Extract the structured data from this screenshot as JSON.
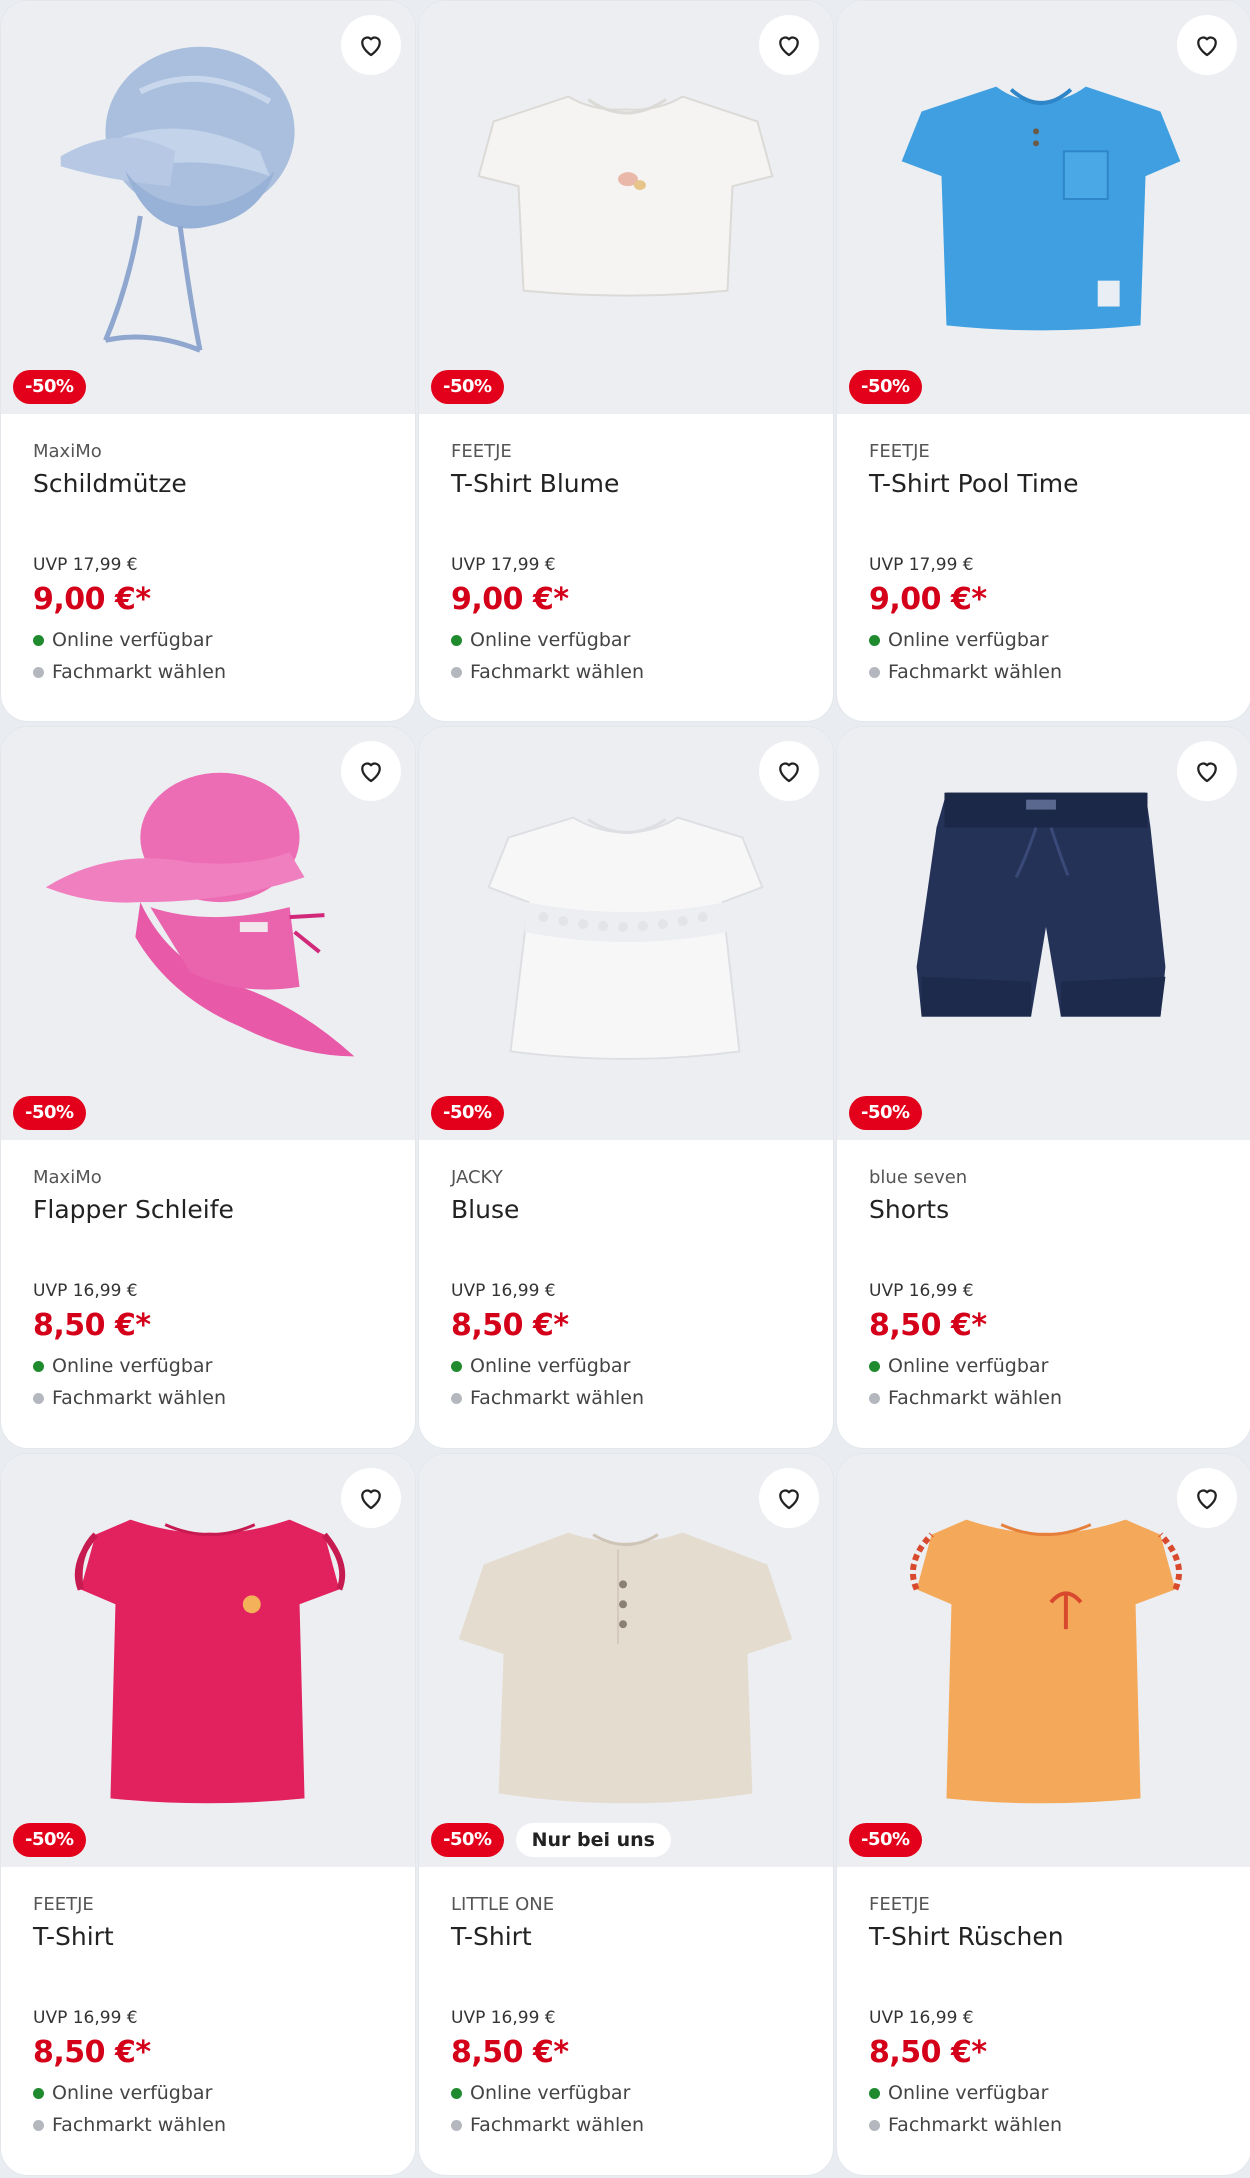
{
  "colors": {
    "sale_badge": "#e2001a",
    "price": "#d40019",
    "online_dot": "#1f8a2e",
    "store_dot": "#b4b8be",
    "image_bg": "#eceef2"
  },
  "products": [
    {
      "brand": "MaxiMo",
      "name": "Schildmütze",
      "uvp": "UVP 17,99 €",
      "price": "9,00 €*",
      "discount": "-50%",
      "note": "",
      "online": "Online verfügbar",
      "store": "Fachmarkt wählen",
      "icon": "light-blue-cap-icon"
    },
    {
      "brand": "FEETJE",
      "name": "T-Shirt Blume",
      "uvp": "UVP 17,99 €",
      "price": "9,00 €*",
      "discount": "-50%",
      "note": "",
      "online": "Online verfügbar",
      "store": "Fachmarkt wählen",
      "icon": "white-tshirt-icon"
    },
    {
      "brand": "FEETJE",
      "name": "T-Shirt Pool Time",
      "uvp": "UVP 17,99 €",
      "price": "9,00 €*",
      "discount": "-50%",
      "note": "",
      "online": "Online verfügbar",
      "store": "Fachmarkt wählen",
      "icon": "blue-tshirt-icon"
    },
    {
      "brand": "MaxiMo",
      "name": "Flapper Schleife",
      "uvp": "UVP 16,99 €",
      "price": "8,50 €*",
      "discount": "-50%",
      "note": "",
      "online": "Online verfügbar",
      "store": "Fachmarkt wählen",
      "icon": "pink-sun-hat-icon"
    },
    {
      "brand": "JACKY",
      "name": "Bluse",
      "uvp": "UVP 16,99 €",
      "price": "8,50 €*",
      "discount": "-50%",
      "note": "",
      "online": "Online verfügbar",
      "store": "Fachmarkt wählen",
      "icon": "white-blouse-icon"
    },
    {
      "brand": "blue seven",
      "name": "Shorts",
      "uvp": "UVP 16,99 €",
      "price": "8,50 €*",
      "discount": "-50%",
      "note": "",
      "online": "Online verfügbar",
      "store": "Fachmarkt wählen",
      "icon": "navy-shorts-icon"
    },
    {
      "brand": "FEETJE",
      "name": "T-Shirt",
      "uvp": "UVP 16,99 €",
      "price": "8,50 €*",
      "discount": "-50%",
      "note": "",
      "online": "Online verfügbar",
      "store": "Fachmarkt wählen",
      "icon": "pink-ruffle-top-icon"
    },
    {
      "brand": "LITTLE ONE",
      "name": "T-Shirt",
      "uvp": "UVP 16,99 €",
      "price": "8,50 €*",
      "discount": "-50%",
      "note": "Nur bei uns",
      "online": "Online verfügbar",
      "store": "Fachmarkt wählen",
      "icon": "beige-muslin-shirt-icon"
    },
    {
      "brand": "FEETJE",
      "name": "T-Shirt Rüschen",
      "uvp": "UVP 16,99 €",
      "price": "8,50 €*",
      "discount": "-50%",
      "note": "",
      "online": "Online verfügbar",
      "store": "Fachmarkt wählen",
      "icon": "orange-ruffle-shirt-icon"
    }
  ]
}
